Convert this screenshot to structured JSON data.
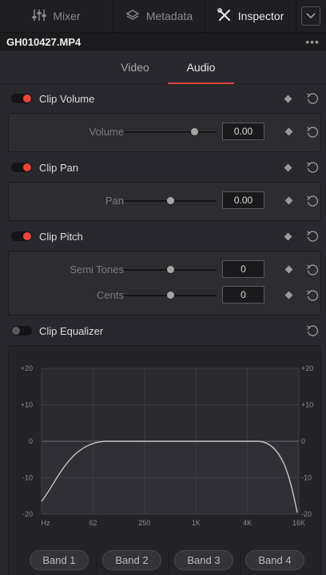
{
  "topbar": {
    "mixer": "Mixer",
    "metadata": "Metadata",
    "inspector": "Inspector"
  },
  "file": {
    "name": "GH010427.MP4",
    "more": "•••"
  },
  "tabs": [
    {
      "label": "Video",
      "active": false
    },
    {
      "label": "Audio",
      "active": true
    }
  ],
  "sections": {
    "clip_volume": {
      "title": "Clip Volume",
      "enabled": true,
      "params": [
        {
          "label": "Volume",
          "value": "0.00",
          "slider": 0.76
        }
      ]
    },
    "clip_pan": {
      "title": "Clip Pan",
      "enabled": true,
      "params": [
        {
          "label": "Pan",
          "value": "0.00",
          "slider": 0.5
        }
      ]
    },
    "clip_pitch": {
      "title": "Clip Pitch",
      "enabled": true,
      "params": [
        {
          "label": "Semi Tones",
          "value": "0",
          "slider": 0.5
        },
        {
          "label": "Cents",
          "value": "0",
          "slider": 0.5
        }
      ]
    },
    "clip_equalizer": {
      "title": "Clip Equalizer",
      "enabled": false
    }
  },
  "eq": {
    "y_ticks": [
      "+20",
      "+10",
      "0",
      "-10",
      "-20"
    ],
    "x_ticks": [
      "Hz",
      "62",
      "250",
      "1K",
      "4K",
      "16K"
    ],
    "curve_color": "#c8c8c8",
    "grid_color": "#3c3c42"
  },
  "bands": [
    "Band 1",
    "Band 2",
    "Band 3",
    "Band 4"
  ],
  "colors": {
    "accent": "#e0483f",
    "toggle_on": "#e8463c"
  }
}
